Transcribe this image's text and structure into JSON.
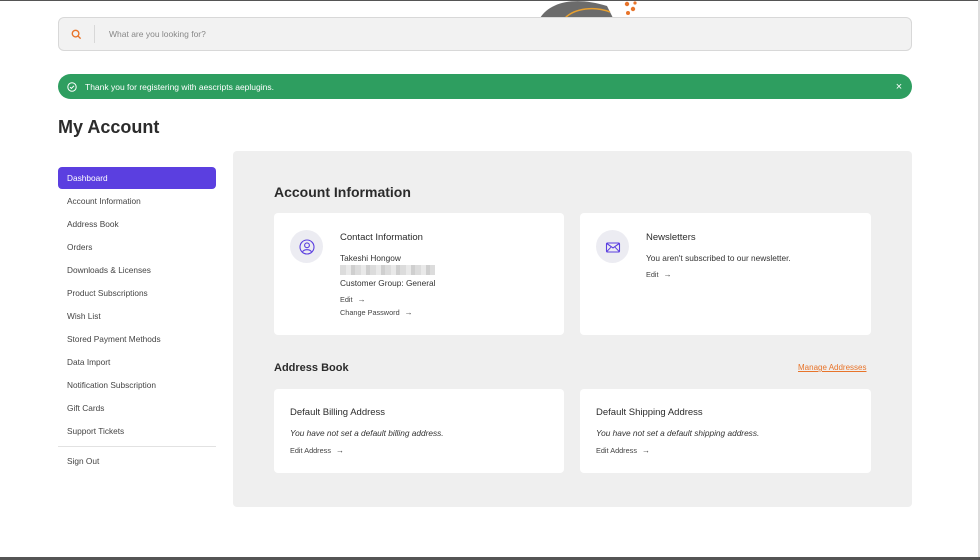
{
  "search": {
    "placeholder": "What are you looking for?"
  },
  "alert": {
    "message": "Thank you for registering with aescripts aeplugins.",
    "close": "×"
  },
  "page_title": "My Account",
  "sidebar": {
    "items": [
      {
        "label": "Dashboard",
        "active": true
      },
      {
        "label": "Account Information"
      },
      {
        "label": "Address Book"
      },
      {
        "label": "Orders"
      },
      {
        "label": "Downloads & Licenses"
      },
      {
        "label": "Product Subscriptions"
      },
      {
        "label": "Wish List"
      },
      {
        "label": "Stored Payment Methods"
      },
      {
        "label": "Data Import"
      },
      {
        "label": "Notification Subscription"
      },
      {
        "label": "Gift Cards"
      },
      {
        "label": "Support Tickets"
      }
    ],
    "sign_out": "Sign Out"
  },
  "account_info": {
    "title": "Account Information",
    "contact": {
      "title": "Contact Information",
      "name": "Takeshi Hongow",
      "group": "Customer Group: General",
      "edit": "Edit",
      "change_password": "Change Password"
    },
    "newsletters": {
      "title": "Newsletters",
      "text": "You aren't subscribed to our newsletter.",
      "edit": "Edit"
    }
  },
  "address_book": {
    "title": "Address Book",
    "manage": "Manage Addresses",
    "billing": {
      "title": "Default Billing Address",
      "text": "You have not set a default billing address.",
      "edit": "Edit Address"
    },
    "shipping": {
      "title": "Default Shipping Address",
      "text": "You have not set a default shipping address.",
      "edit": "Edit Address"
    }
  },
  "colors": {
    "accent": "#5b3fe0",
    "success": "#2e9e60",
    "link": "#e8742a",
    "panel": "#efefef"
  },
  "icons": [
    "search-icon",
    "check-circle-icon",
    "close-icon",
    "user-icon",
    "envelope-icon",
    "arrow-right-icon"
  ]
}
